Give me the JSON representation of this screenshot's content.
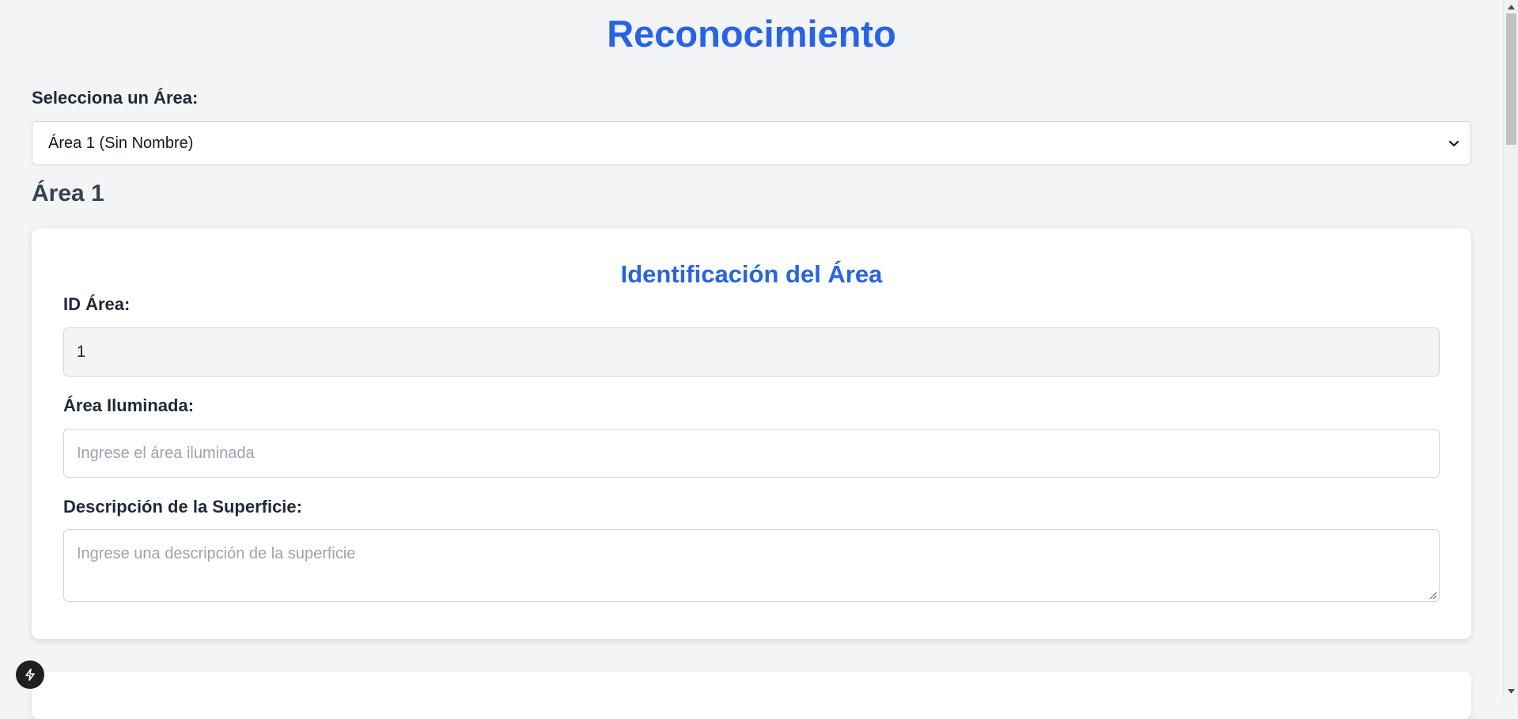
{
  "page": {
    "title": "Reconocimiento",
    "accent_color": "#2563eb"
  },
  "area_select": {
    "label": "Selecciona un Área:",
    "selected_value": "Área 1 (Sin Nombre)"
  },
  "area_heading": "Área 1",
  "identification_card": {
    "title": "Identificación del Área",
    "fields": {
      "id_area": {
        "label": "ID Área:",
        "value": "1"
      },
      "area_iluminada": {
        "label": "Área Iluminada:",
        "placeholder": "Ingrese el área iluminada"
      },
      "descripcion_superficie": {
        "label": "Descripción de la Superficie:",
        "placeholder": "Ingrese una descripción de la superficie"
      }
    }
  },
  "icons": {
    "select_chevron": "chevron-down-icon",
    "floating_button": "lightning-bolt-icon"
  }
}
